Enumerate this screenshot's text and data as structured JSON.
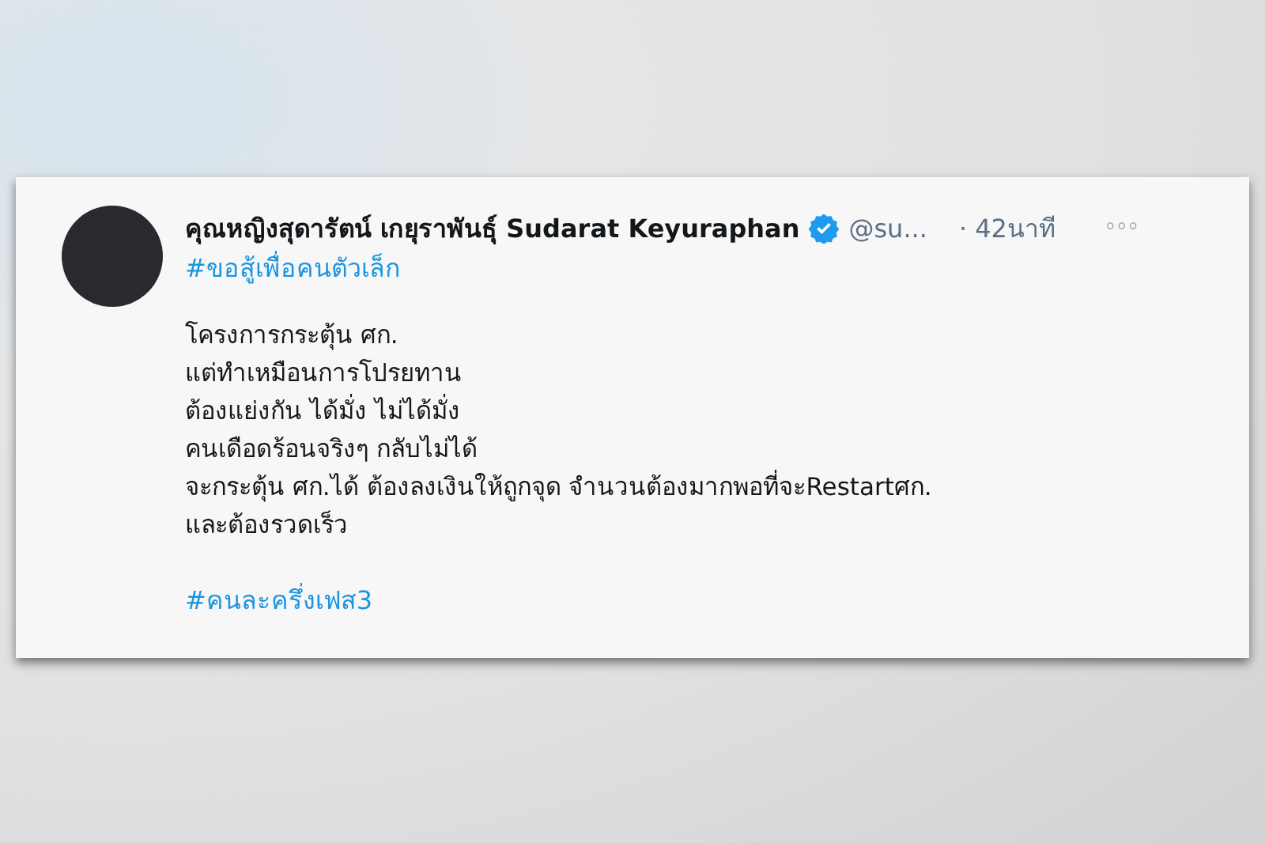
{
  "tweet": {
    "display_name": "คุณหญิงสุดารัตน์ เกยุราพันธุ์ Sudarat Keyuraphan",
    "verified": true,
    "handle": "@su...",
    "time": "· 42นาที",
    "more": "◦◦◦",
    "hashtag_top": "#ขอสู้เพื่อคนตัวเล็ก",
    "body_lines": [
      "โครงการกระตุ้น ศก.",
      "แต่ทำเหมือนการโปรยทาน",
      "ต้องแย่งกัน ได้มั่ง ไม่ได้มั่ง",
      "คนเดือดร้อนจริงๆ กลับไม่ได้",
      "จะกระตุ้น ศก.ได้ ต้องลงเงินให้ถูกจุด จำนวนต้องมากพอที่จะRestartศก.",
      "และต้องรวดเร็ว"
    ],
    "hashtag_bottom": "#คนละครึ่งเฟส3"
  }
}
